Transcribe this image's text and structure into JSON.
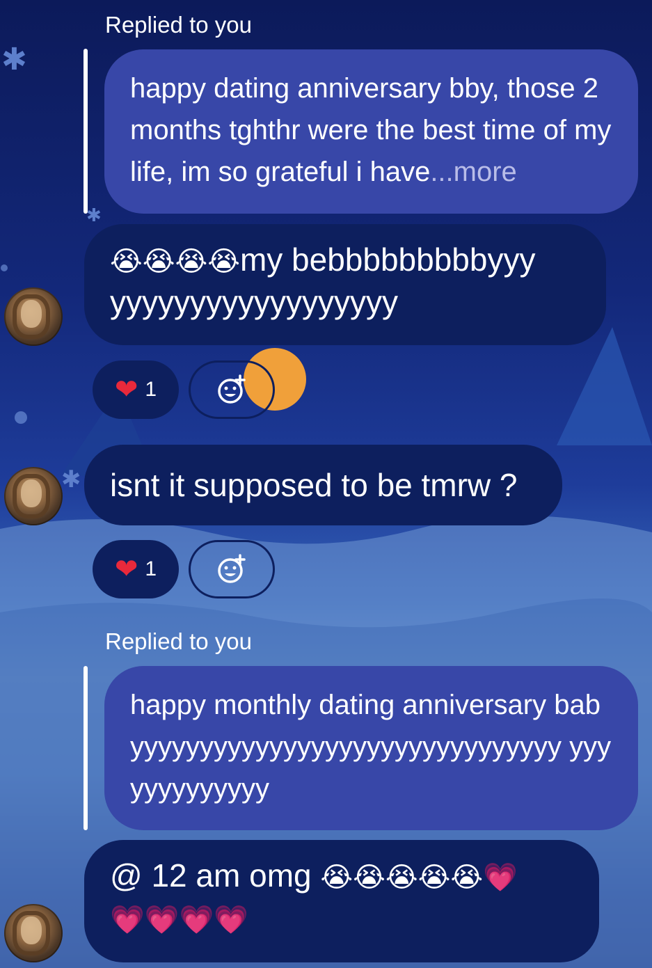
{
  "thread": {
    "messages": [
      {
        "type": "reply_quote",
        "reply_label": "Replied to you",
        "quoted_text": "happy dating anniversary bby, those 2 months tghthr were the best time of my life, im so grateful i have",
        "quoted_ellipsis": "...",
        "more_label": "more"
      },
      {
        "type": "incoming",
        "emojis": "😭😭😭😭",
        "text": "my bebbbbbbbbbyyy yyyyyyyyyyyyyyyyyy",
        "reaction": {
          "icon": "heart-icon",
          "count": "1"
        },
        "add_reaction_icon": "add-reaction-icon"
      },
      {
        "type": "incoming",
        "text": "isnt it supposed to be tmrw ?",
        "reaction": {
          "icon": "heart-icon",
          "count": "1"
        },
        "add_reaction_icon": "add-reaction-icon"
      },
      {
        "type": "reply_quote",
        "reply_label": "Replied to you",
        "quoted_text": "happy monthly dating anniversary babyyyyyyyyyyyyyyyyyyyyyyyyyyyyyyy yyyyyyyyyyyyy"
      },
      {
        "type": "incoming",
        "text": "@ 12 am omg ",
        "emojis_line1": "😭😭😭😭😭💗",
        "emojis_line2": "💗💗💗💗"
      }
    ]
  },
  "colors": {
    "incoming_bubble": "#0d1f5e",
    "quoted_bubble": "#3847a8",
    "heart": "#e8293b",
    "more_link": "#b9bde8"
  }
}
